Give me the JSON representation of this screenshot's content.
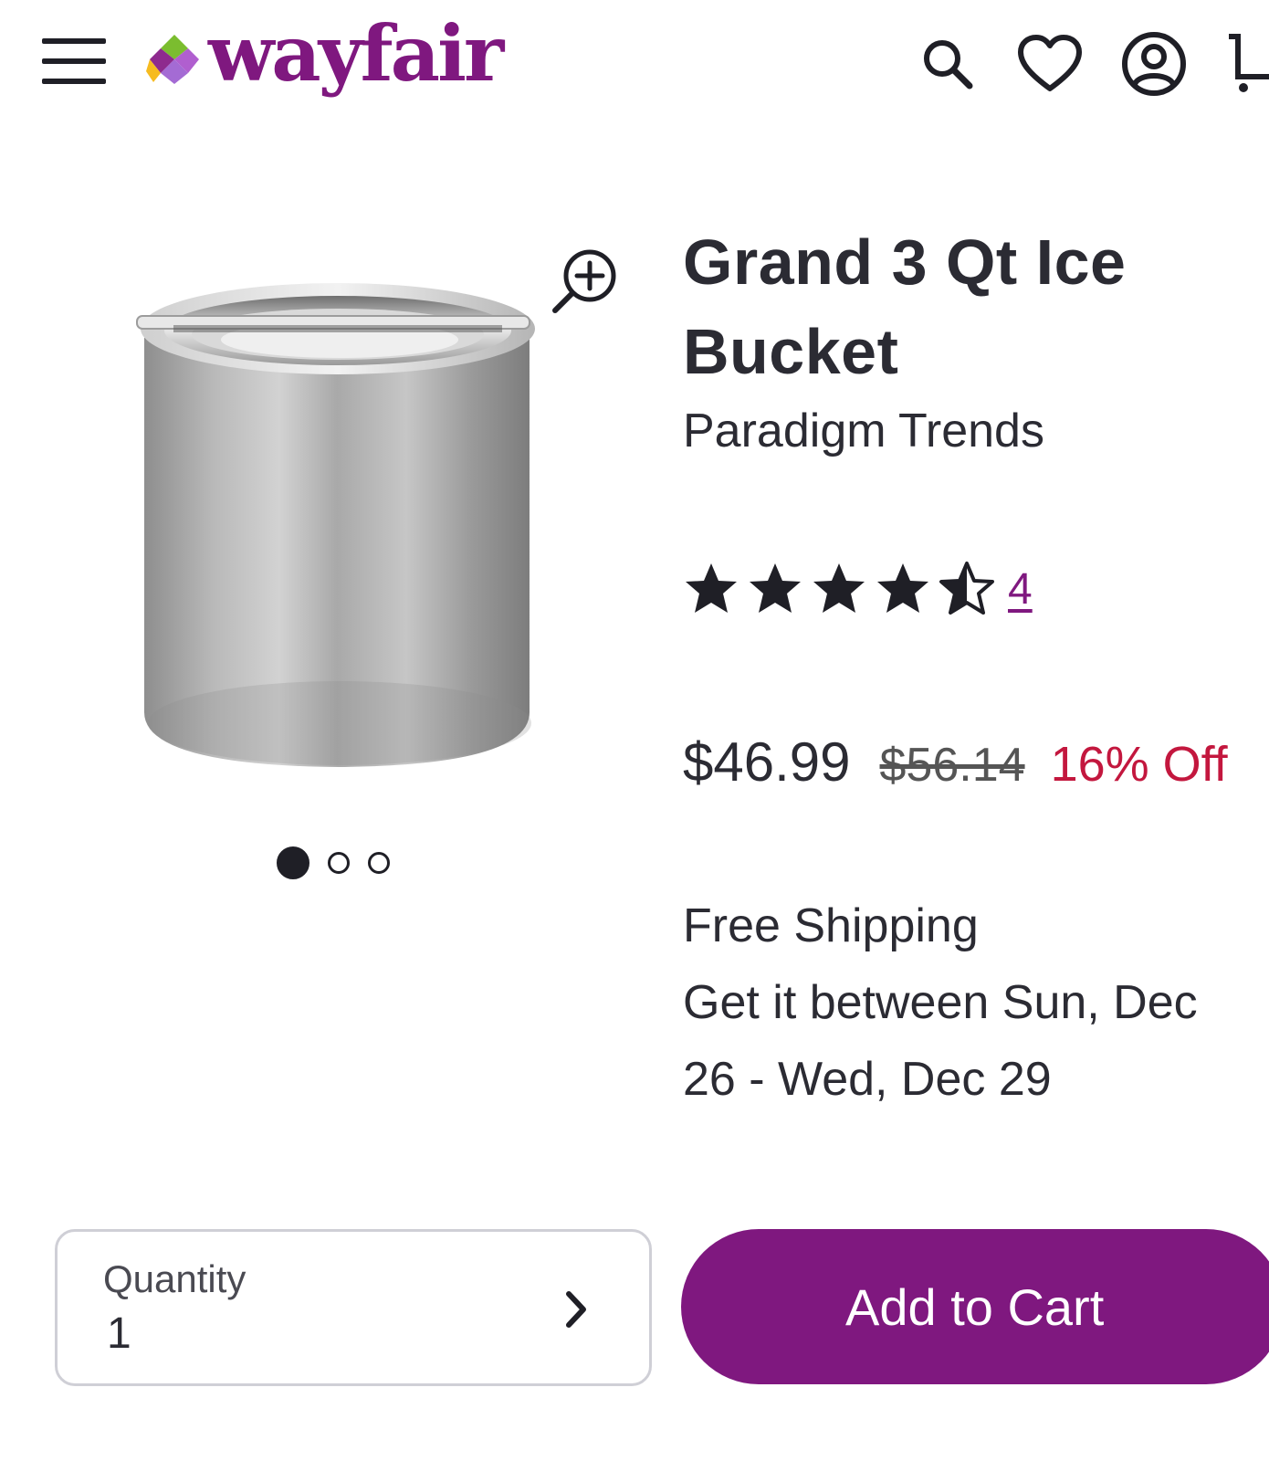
{
  "header": {
    "logo_text": "wayfair",
    "menu_icon": "hamburger-menu-icon",
    "search_icon": "search-icon",
    "favorites_icon": "heart-icon",
    "account_icon": "user-account-icon",
    "cart_icon": "cart-icon",
    "brand_color": "#7f187f"
  },
  "product": {
    "title": "Grand 3 Qt Ice Bucket",
    "brand": "Paradigm Trends",
    "image": "stainless-steel-ice-bucket",
    "gallery": {
      "image_count": 3,
      "active_index": 0
    },
    "rating": {
      "stars": 4.5,
      "max": 5,
      "review_count": "4"
    },
    "price": "$46.99",
    "original_price": "$56.14",
    "discount": "16% Off",
    "discount_color": "#c3173e",
    "shipping": {
      "label": "Free Shipping",
      "delivery_line1": "Get it between Sun, Dec",
      "delivery_line2": "26 - Wed, Dec 29"
    }
  },
  "purchase": {
    "quantity_label": "Quantity",
    "quantity_value": "1",
    "add_to_cart_label": "Add to Cart"
  }
}
